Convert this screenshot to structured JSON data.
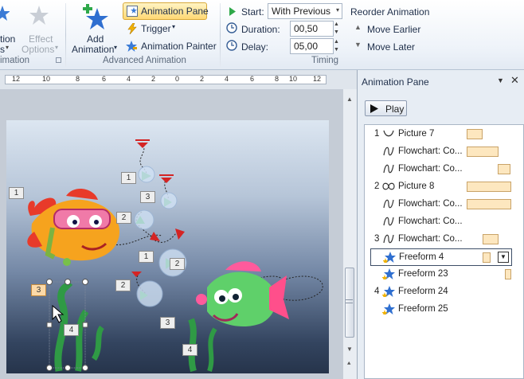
{
  "ribbon": {
    "partial_left_label_1": "tion",
    "partial_left_label_2": "s",
    "partial_left_group": "imation",
    "effect_options_line1": "Effect",
    "effect_options_line2": "Options",
    "add_animation_line1": "Add",
    "add_animation_line2": "Animation",
    "animation_pane": "Animation Pane",
    "trigger": "Trigger",
    "animation_painter": "Animation Painter",
    "advanced_group": "Advanced Animation",
    "start_label": "Start:",
    "start_value": "With Previous",
    "duration_label": "Duration:",
    "duration_value": "00,50",
    "delay_label": "Delay:",
    "delay_value": "05,00",
    "timing_group": "Timing",
    "reorder_title": "Reorder Animation",
    "move_earlier": "Move Earlier",
    "move_later": "Move Later"
  },
  "ruler": {
    "ticks": [
      "12",
      "10",
      "8",
      "6",
      "4",
      "2",
      "0",
      "2",
      "4",
      "6",
      "8",
      "10",
      "12"
    ]
  },
  "slide": {
    "badges": [
      "1",
      "1",
      "3",
      "2",
      "2",
      "1",
      "2",
      "2",
      "3",
      "4",
      "3",
      "4"
    ]
  },
  "pane": {
    "title": "Animation Pane",
    "play": "Play",
    "items": [
      {
        "num": "1",
        "icon": "path-curve-icon",
        "label": "Picture 7"
      },
      {
        "num": "",
        "icon": "path-wave-icon",
        "label": "Flowchart: Co..."
      },
      {
        "num": "",
        "icon": "path-wave-icon",
        "label": "Flowchart: Co..."
      },
      {
        "num": "2",
        "icon": "path-loop-icon",
        "label": "Picture 8"
      },
      {
        "num": "",
        "icon": "path-wave-icon",
        "label": "Flowchart: Co..."
      },
      {
        "num": "",
        "icon": "path-wave-icon",
        "label": "Flowchart: Co..."
      },
      {
        "num": "3",
        "icon": "path-wave-icon",
        "label": "Flowchart: Co..."
      },
      {
        "num": "",
        "icon": "star-effect-icon",
        "label": "Freeform 4"
      },
      {
        "num": "",
        "icon": "star-effect-icon",
        "label": "Freeform 23"
      },
      {
        "num": "4",
        "icon": "star-effect-icon",
        "label": "Freeform 24"
      },
      {
        "num": "",
        "icon": "star-effect-icon",
        "label": "Freeform 25"
      }
    ]
  },
  "colors": {
    "accent": "#ffd874",
    "bar": "#fde7bf",
    "pane_bg": "#e7edf4"
  }
}
